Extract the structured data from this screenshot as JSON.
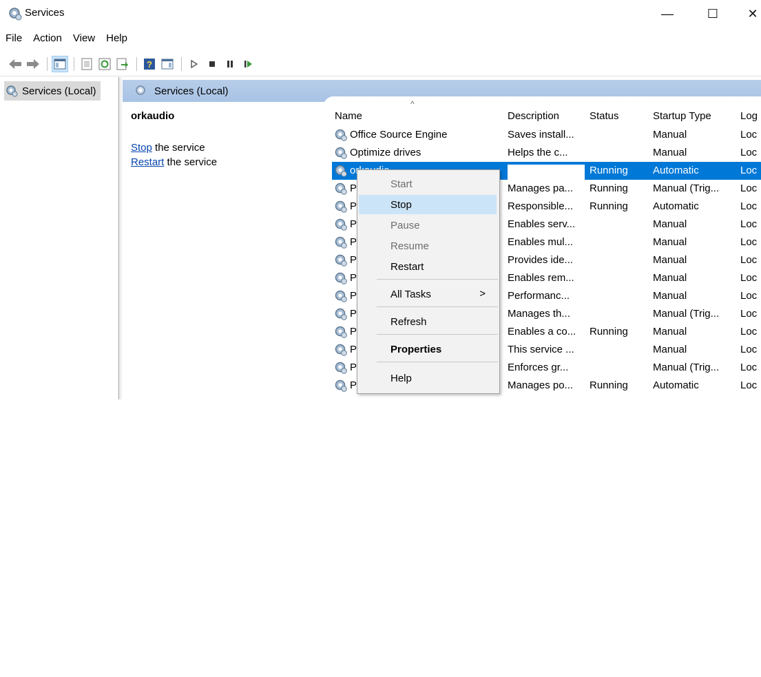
{
  "window": {
    "title": "Services",
    "minimize_glyph": "—",
    "maximize_glyph": "☐",
    "close_glyph": "✕"
  },
  "menu": [
    "File",
    "Action",
    "View",
    "Help"
  ],
  "tree": {
    "item": "Services (Local)"
  },
  "banner": {
    "title": "Services (Local)"
  },
  "description": {
    "service_name": "orkaudio",
    "stop_link": "Stop",
    "stop_suffix": " the service",
    "restart_link": "Restart",
    "restart_suffix": " the service"
  },
  "list": {
    "sort_glyph": "^",
    "columns": {
      "name": "Name",
      "description": "Description",
      "status": "Status",
      "startup": "Startup Type",
      "logon": "Log"
    },
    "rows": [
      {
        "name": "Office  Source Engine",
        "description": "Saves install...",
        "status": "",
        "startup": "Manual",
        "logon": "Loc"
      },
      {
        "name": "Optimize drives",
        "description": "Helps the c...",
        "status": "",
        "startup": "Manual",
        "logon": "Loc"
      },
      {
        "name": "orkaudio",
        "description": "",
        "status": "Running",
        "startup": "Automatic",
        "logon": "Loc"
      },
      {
        "name": "P",
        "description": "Manages pa...",
        "status": "Running",
        "startup": "Manual (Trig...",
        "logon": "Loc"
      },
      {
        "name": "P",
        "description": "Responsible...",
        "status": "Running",
        "startup": "Automatic",
        "logon": "Loc"
      },
      {
        "name": "P",
        "description": "Enables serv...",
        "status": "",
        "startup": "Manual",
        "logon": "Loc"
      },
      {
        "name": "P",
        "description": "Enables mul...",
        "status": "",
        "startup": "Manual",
        "logon": "Loc"
      },
      {
        "name": "P",
        "description": "Provides ide...",
        "status": "",
        "startup": "Manual",
        "logon": "Loc"
      },
      {
        "name": "P",
        "description": "Enables rem...",
        "status": "",
        "startup": "Manual",
        "logon": "Loc"
      },
      {
        "name": "P",
        "description": "Performanc...",
        "status": "",
        "startup": "Manual",
        "logon": "Loc"
      },
      {
        "name": "P",
        "description": "Manages th...",
        "status": "",
        "startup": "Manual (Trig...",
        "logon": "Loc"
      },
      {
        "name": "P",
        "description": "Enables a co...",
        "status": "Running",
        "startup": "Manual",
        "logon": "Loc"
      },
      {
        "name": "P",
        "description": "This service ...",
        "status": "",
        "startup": "Manual",
        "logon": "Loc"
      },
      {
        "name": "P",
        "description": "Enforces gr...",
        "status": "",
        "startup": "Manual (Trig...",
        "logon": "Loc"
      },
      {
        "name": "Power",
        "description": "Manages po...",
        "status": "Running",
        "startup": "Automatic",
        "logon": "Loc"
      }
    ]
  },
  "context_menu": {
    "items": [
      "Start",
      "Stop",
      "Pause",
      "Resume",
      "Restart",
      "All Tasks",
      "Refresh",
      "Properties",
      "Help"
    ],
    "submenu_arrow": ">"
  },
  "colors": {
    "selection": "#0078d7",
    "menu_highlight": "#cce4f7",
    "banner": "#b7cde9",
    "link": "#0645ad"
  }
}
